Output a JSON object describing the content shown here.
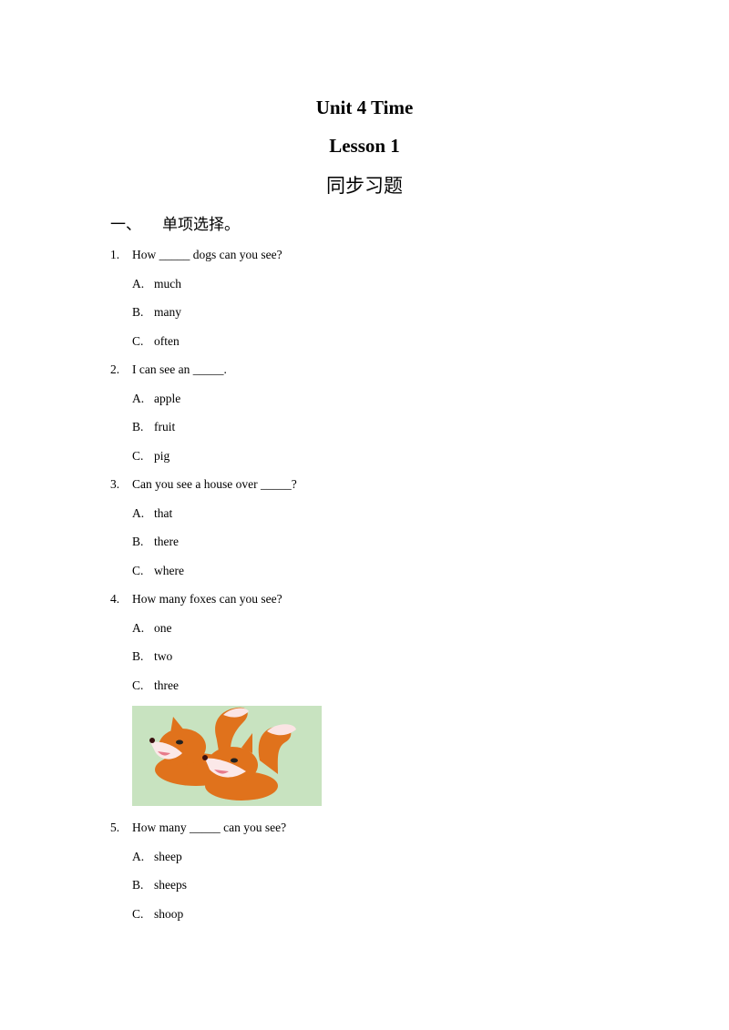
{
  "header": {
    "title": "Unit 4 Time",
    "lesson": "Lesson 1",
    "subtitle": "同步习题"
  },
  "section": {
    "number": "一、",
    "title": "单项选择。"
  },
  "questions": [
    {
      "number": "1.",
      "text": "How _____ dogs can you see?",
      "options": [
        {
          "letter": "A.",
          "text": "much"
        },
        {
          "letter": "B.",
          "text": "many"
        },
        {
          "letter": "C.",
          "text": "often"
        }
      ]
    },
    {
      "number": "2.",
      "text": "I can see an _____.",
      "options": [
        {
          "letter": "A.",
          "text": "apple"
        },
        {
          "letter": "B.",
          "text": "fruit"
        },
        {
          "letter": "C.",
          "text": "pig"
        }
      ]
    },
    {
      "number": "3.",
      "text": "Can you see a house over _____?",
      "options": [
        {
          "letter": "A.",
          "text": "that"
        },
        {
          "letter": "B.",
          "text": "there"
        },
        {
          "letter": "C.",
          "text": "where"
        }
      ]
    },
    {
      "number": "4.",
      "text": "How many foxes can you see?",
      "options": [
        {
          "letter": "A.",
          "text": "one"
        },
        {
          "letter": "B.",
          "text": "two"
        },
        {
          "letter": "C.",
          "text": "three"
        }
      ]
    },
    {
      "number": "5.",
      "text": "How many _____ can you see?",
      "options": [
        {
          "letter": "A.",
          "text": "sheep"
        },
        {
          "letter": "B.",
          "text": "sheeps"
        },
        {
          "letter": "C.",
          "text": "shoop"
        }
      ]
    }
  ],
  "image": {
    "description": "two cartoon foxes",
    "background_color": "#c8e3c0",
    "fox_color": "#e0721c"
  }
}
